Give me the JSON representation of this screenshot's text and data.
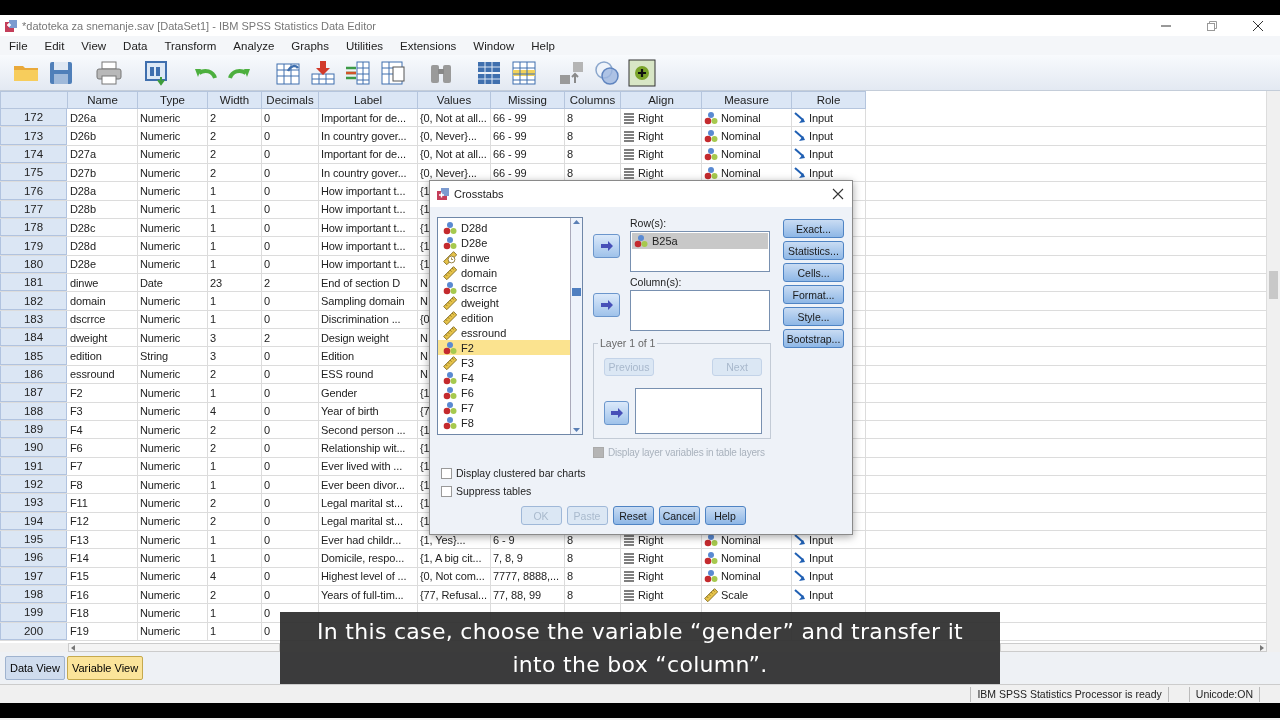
{
  "window": {
    "title": "*datoteka za snemanje.sav [DataSet1] - IBM SPSS Statistics Data Editor"
  },
  "menu": [
    "File",
    "Edit",
    "View",
    "Data",
    "Transform",
    "Analyze",
    "Graphs",
    "Utilities",
    "Extensions",
    "Window",
    "Help"
  ],
  "table": {
    "columns": [
      "Name",
      "Type",
      "Width",
      "Decimals",
      "Label",
      "Values",
      "Missing",
      "Columns",
      "Align",
      "Measure",
      "Role"
    ],
    "rows": [
      {
        "number": "172",
        "kind": "nominal",
        "cells": [
          "D26a",
          "Numeric",
          "2",
          "0",
          "Important for de...",
          "{0, Not at all...",
          "66 - 99",
          "8",
          "Right",
          "Nominal",
          "Input"
        ]
      },
      {
        "number": "173",
        "kind": "nominal",
        "cells": [
          "D26b",
          "Numeric",
          "2",
          "0",
          "In country gover...",
          "{0, Never}...",
          "66 - 99",
          "8",
          "Right",
          "Nominal",
          "Input"
        ]
      },
      {
        "number": "174",
        "kind": "nominal",
        "cells": [
          "D27a",
          "Numeric",
          "2",
          "0",
          "Important for de...",
          "{0, Not at all...",
          "66 - 99",
          "8",
          "Right",
          "Nominal",
          "Input"
        ]
      },
      {
        "number": "175",
        "kind": "nominal",
        "cells": [
          "D27b",
          "Numeric",
          "2",
          "0",
          "In country gover...",
          "{0, Never}...",
          "66 - 99",
          "8",
          "Right",
          "Nominal",
          "Input"
        ]
      },
      {
        "number": "176",
        "cells": [
          "D28a",
          "Numeric",
          "1",
          "0",
          "How important t...",
          "{1"
        ]
      },
      {
        "number": "177",
        "cells": [
          "D28b",
          "Numeric",
          "1",
          "0",
          "How important t...",
          "{1"
        ]
      },
      {
        "number": "178",
        "cells": [
          "D28c",
          "Numeric",
          "1",
          "0",
          "How important t...",
          "{1"
        ]
      },
      {
        "number": "179",
        "cells": [
          "D28d",
          "Numeric",
          "1",
          "0",
          "How important t...",
          "{1"
        ]
      },
      {
        "number": "180",
        "cells": [
          "D28e",
          "Numeric",
          "1",
          "0",
          "How important t...",
          "{1"
        ]
      },
      {
        "number": "181",
        "cells": [
          "dinwe",
          "Date",
          "23",
          "2",
          "End of section D",
          "N"
        ]
      },
      {
        "number": "182",
        "cells": [
          "domain",
          "Numeric",
          "1",
          "0",
          "Sampling domain",
          "N"
        ]
      },
      {
        "number": "183",
        "cells": [
          "dscrrce",
          "Numeric",
          "1",
          "0",
          "Discrimination ...",
          "{0"
        ]
      },
      {
        "number": "184",
        "cells": [
          "dweight",
          "Numeric",
          "3",
          "2",
          "Design weight",
          "N"
        ]
      },
      {
        "number": "185",
        "cells": [
          "edition",
          "String",
          "3",
          "0",
          "Edition",
          "N"
        ]
      },
      {
        "number": "186",
        "cells": [
          "essround",
          "Numeric",
          "2",
          "0",
          "ESS round",
          "N"
        ]
      },
      {
        "number": "187",
        "cells": [
          "F2",
          "Numeric",
          "1",
          "0",
          "Gender",
          "{1"
        ]
      },
      {
        "number": "188",
        "cells": [
          "F3",
          "Numeric",
          "4",
          "0",
          "Year of birth",
          "{7"
        ]
      },
      {
        "number": "189",
        "cells": [
          "F4",
          "Numeric",
          "2",
          "0",
          "Second person ...",
          "{1"
        ]
      },
      {
        "number": "190",
        "cells": [
          "F6",
          "Numeric",
          "2",
          "0",
          "Relationship wit...",
          "{1"
        ]
      },
      {
        "number": "191",
        "cells": [
          "F7",
          "Numeric",
          "1",
          "0",
          "Ever lived with ...",
          "{1"
        ]
      },
      {
        "number": "192",
        "cells": [
          "F8",
          "Numeric",
          "1",
          "0",
          "Ever been divor...",
          "{1"
        ]
      },
      {
        "number": "193",
        "cells": [
          "F11",
          "Numeric",
          "2",
          "0",
          "Legal marital st...",
          "{1"
        ]
      },
      {
        "number": "194",
        "cells": [
          "F12",
          "Numeric",
          "2",
          "0",
          "Legal marital st...",
          "{1"
        ]
      },
      {
        "number": "195",
        "kind": "nominal",
        "cells": [
          "F13",
          "Numeric",
          "1",
          "0",
          "Ever had childr...",
          "{1, Yes}...",
          "6 - 9",
          "8",
          "Right",
          "Nominal",
          "Input"
        ]
      },
      {
        "number": "196",
        "kind": "nominal",
        "cells": [
          "F14",
          "Numeric",
          "1",
          "0",
          "Domicile, respo...",
          "{1, A big cit...",
          "7, 8, 9",
          "8",
          "Right",
          "Nominal",
          "Input"
        ]
      },
      {
        "number": "197",
        "kind": "nominal",
        "cells": [
          "F15",
          "Numeric",
          "4",
          "0",
          "Highest level of ...",
          "{0, Not com...",
          "7777, 8888,...",
          "8",
          "Right",
          "Nominal",
          "Input"
        ]
      },
      {
        "number": "198",
        "kind": "scale",
        "cells": [
          "F16",
          "Numeric",
          "2",
          "0",
          "Years of full-tim...",
          "{77, Refusal...",
          "77, 88, 99",
          "8",
          "Right",
          "Scale",
          "Input"
        ]
      },
      {
        "number": "199",
        "cells": [
          "F18",
          "Numeric",
          "1",
          "0"
        ]
      },
      {
        "number": "200",
        "cells": [
          "F19",
          "Numeric",
          "1",
          "0"
        ]
      }
    ]
  },
  "dialog": {
    "title": "Crosstabs",
    "variables": [
      {
        "name": "D28d",
        "kind": "nominal",
        "selected": false
      },
      {
        "name": "D28e",
        "kind": "nominal",
        "selected": false
      },
      {
        "name": "dinwe",
        "kind": "date",
        "selected": false
      },
      {
        "name": "domain",
        "kind": "scale",
        "selected": false
      },
      {
        "name": "dscrrce",
        "kind": "nominal",
        "selected": false
      },
      {
        "name": "dweight",
        "kind": "scale",
        "selected": false
      },
      {
        "name": "edition",
        "kind": "scale",
        "selected": false
      },
      {
        "name": "essround",
        "kind": "scale",
        "selected": false
      },
      {
        "name": "F2",
        "kind": "nominal",
        "selected": true
      },
      {
        "name": "F3",
        "kind": "scale",
        "selected": false
      },
      {
        "name": "F4",
        "kind": "nominal",
        "selected": false
      },
      {
        "name": "F6",
        "kind": "nominal",
        "selected": false
      },
      {
        "name": "F7",
        "kind": "nominal",
        "selected": false
      },
      {
        "name": "F8",
        "kind": "nominal",
        "selected": false
      }
    ],
    "rows_label": "Row(s):",
    "rows": [
      {
        "name": "B25a",
        "kind": "nominal",
        "selected": true
      }
    ],
    "columns_label": "Column(s):",
    "layer": {
      "title": "Layer 1 of 1",
      "previous": {
        "label": "Previous",
        "disabled": true
      },
      "next": {
        "label": "Next",
        "disabled": true
      }
    },
    "display_layer": {
      "label": "Display layer variables in table layers",
      "checked": false,
      "disabled": true
    },
    "side_buttons": [
      "Exact...",
      "Statistics...",
      "Cells...",
      "Format...",
      "Style...",
      "Bootstrap..."
    ],
    "options": [
      {
        "label": "Display clustered bar charts",
        "checked": false
      },
      {
        "label": "Suppress tables",
        "checked": false
      }
    ],
    "buttons": [
      {
        "label": "OK",
        "disabled": true
      },
      {
        "label": "Paste",
        "disabled": true
      },
      {
        "label": "Reset",
        "disabled": false
      },
      {
        "label": "Cancel",
        "disabled": false
      },
      {
        "label": "Help",
        "disabled": false
      }
    ]
  },
  "view_tabs": [
    {
      "label": "Data View",
      "selected": false
    },
    {
      "label": "Variable View",
      "selected": true
    }
  ],
  "status_bar": [
    "IBM SPSS Statistics Processor is ready",
    "Unicode:ON"
  ],
  "subtitle": "In this case, choose the variable “gender” and transfer it into the box “column”."
}
